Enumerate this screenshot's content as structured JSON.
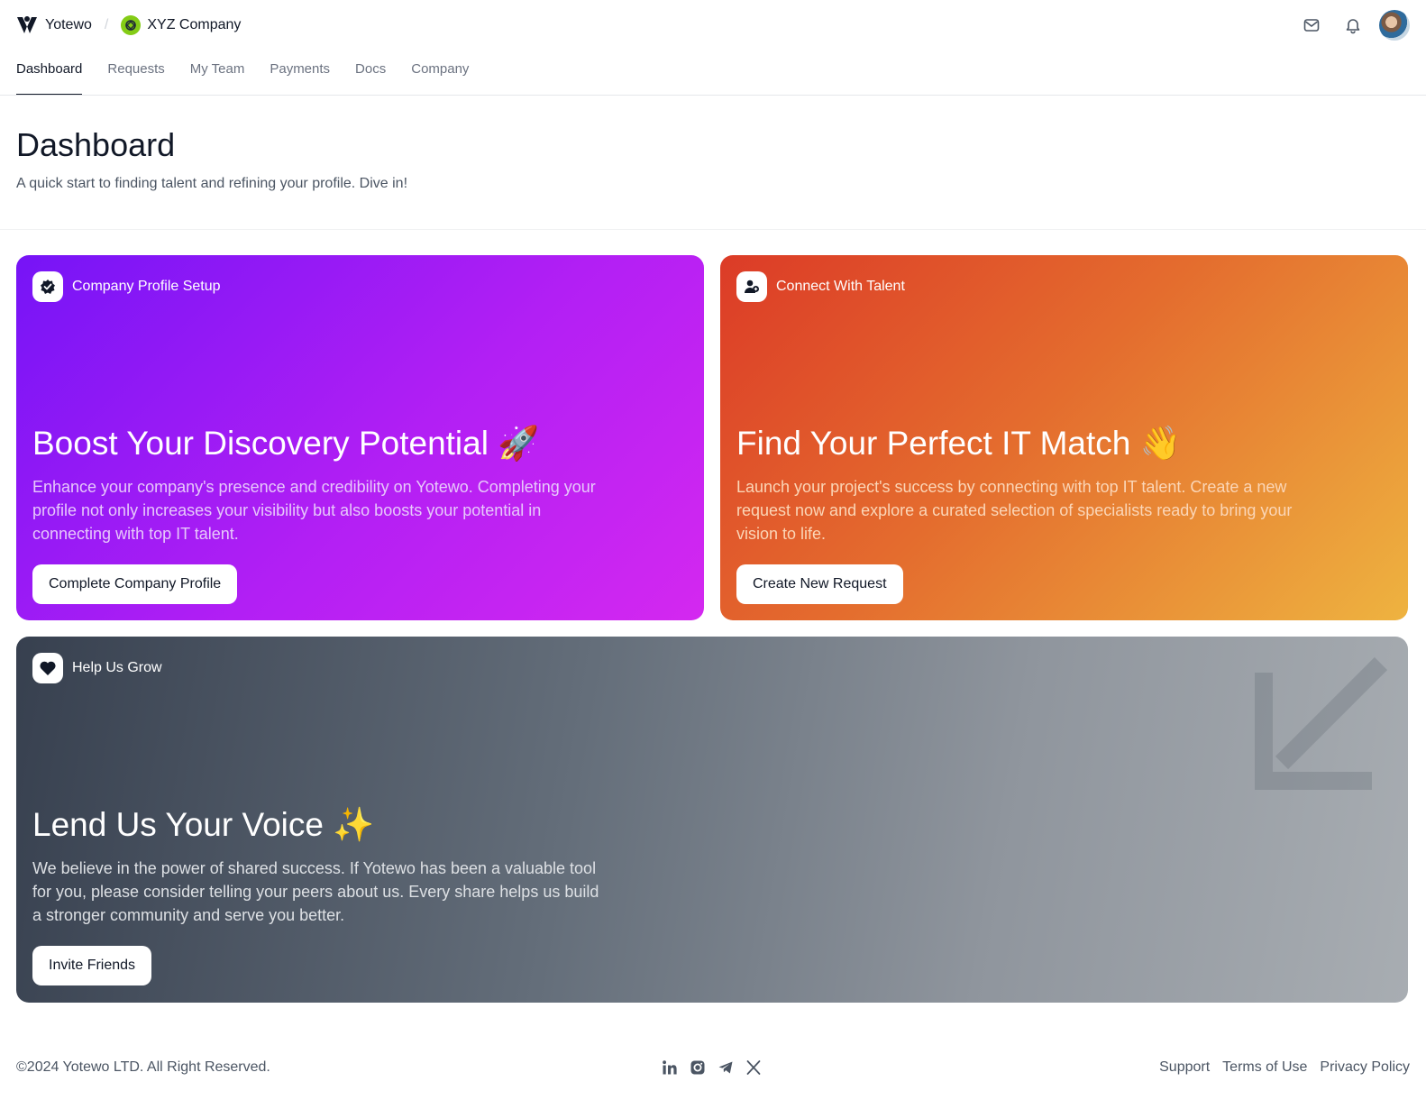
{
  "header": {
    "brand": "Yotewo",
    "separator": "/",
    "company": "XYZ Company",
    "icons": [
      "mail-icon",
      "bell-icon"
    ]
  },
  "nav": {
    "items": [
      {
        "label": "Dashboard",
        "active": true
      },
      {
        "label": "Requests",
        "active": false
      },
      {
        "label": "My Team",
        "active": false
      },
      {
        "label": "Payments",
        "active": false
      },
      {
        "label": "Docs",
        "active": false
      },
      {
        "label": "Company",
        "active": false
      }
    ]
  },
  "page": {
    "title": "Dashboard",
    "subtitle": "A quick start to finding talent and refining your profile. Dive in!"
  },
  "cards": {
    "profile": {
      "tag": "Company Profile Setup",
      "title": "Boost Your Discovery Potential 🚀",
      "description": "Enhance your company's presence and credibility on Yotewo. Completing your profile not only increases your visibility but also boosts your potential in connecting with top IT talent.",
      "button": "Complete Company Profile",
      "icon": "verified-badge-icon"
    },
    "talent": {
      "tag": "Connect With Talent",
      "title": "Find Your Perfect IT Match 👋",
      "description": "Launch your project's success by connecting with top IT talent. Create a new request now and explore a curated selection of specialists ready to bring your vision to life.",
      "button": "Create New Request",
      "icon": "users-icon"
    },
    "grow": {
      "tag": "Help Us Grow",
      "title": "Lend Us Your Voice ✨",
      "description": "We believe in the power of shared success. If Yotewo has been a valuable tool for you, please consider telling your peers about us. Every share helps us build a stronger community and serve you better.",
      "button": "Invite Friends",
      "icon": "heart-icon"
    }
  },
  "colors": {
    "purple_start": "#7614f6",
    "purple_end": "#d428f0",
    "orange_start": "#dc3b27",
    "orange_end": "#eeb340",
    "gray_start": "#37404f",
    "gray_end": "#a8adb2"
  },
  "footer": {
    "copyright": "©2024 Yotewo LTD. All Right Reserved.",
    "socials": [
      "linkedin-icon",
      "instagram-icon",
      "telegram-icon",
      "x-icon"
    ],
    "links": [
      "Support",
      "Terms of Use",
      "Privacy Policy"
    ]
  }
}
